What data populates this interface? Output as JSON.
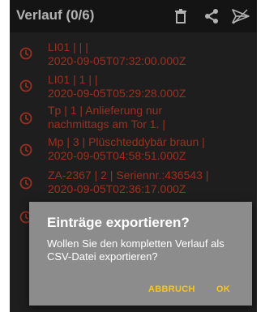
{
  "appbar": {
    "title": "Verlauf (0/6)",
    "actions": [
      {
        "icon": "trash-icon"
      },
      {
        "icon": "share-icon"
      },
      {
        "icon": "send-icon"
      }
    ]
  },
  "history": {
    "accent_color": "#e0452f",
    "items": [
      {
        "icon": "clock-icon",
        "text": "LI01 |  |  |\n2020-09-05T07:32:00.000Z"
      },
      {
        "icon": "clock-icon",
        "text": "LI01 | 1 |  |\n2020-09-05T05:29:28.000Z"
      },
      {
        "icon": "clock-icon",
        "text": "Tp | 1 | Anlieferung nur\nnachmittags am Tor 1. |"
      },
      {
        "icon": "clock-icon",
        "text": "Mp | 3 | Plüschteddybär braun |\n2020-09-05T04:58:51.000Z"
      },
      {
        "icon": "clock-icon",
        "text": "ZA-2367 | 2 | Seriennr.:436543 |\n2020-09-05T02:36:17.000Z"
      },
      {
        "icon": "clock-icon",
        "text": ""
      }
    ]
  },
  "dialog": {
    "title": "Einträge exportieren?",
    "message": "Wollen Sie den kompletten Verlauf als CSV-Datei exportieren?",
    "cancel_label": "ABBRUCH",
    "ok_label": "OK",
    "button_color": "#f7c61a"
  }
}
